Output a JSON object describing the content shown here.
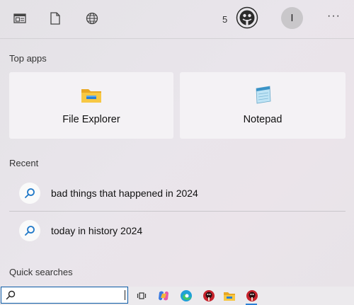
{
  "header": {
    "points": "5",
    "user_initial": "I",
    "more_label": "···",
    "icons": [
      "news-icon",
      "document-icon",
      "globe-icon",
      "rewards-icon"
    ]
  },
  "top_apps": {
    "title": "Top apps",
    "apps": [
      {
        "label": "File Explorer",
        "icon": "folder-icon"
      },
      {
        "label": "Notepad",
        "icon": "notepad-icon"
      }
    ]
  },
  "recent": {
    "title": "Recent",
    "items": [
      {
        "label": "bad things that happened in 2024",
        "icon": "search-icon"
      },
      {
        "label": "today in history 2024",
        "icon": "search-icon"
      }
    ]
  },
  "quick_searches": {
    "title": "Quick searches"
  },
  "taskbar": {
    "search_value": "",
    "icons": [
      "task-view-icon",
      "copilot-icon",
      "edge-icon",
      "app-icon",
      "file-explorer-icon",
      "app-icon"
    ]
  },
  "colors": {
    "accent": "#0b5aa5",
    "folder_yellow": "#f5c02a",
    "edge_blue": "#1fa0d8"
  }
}
